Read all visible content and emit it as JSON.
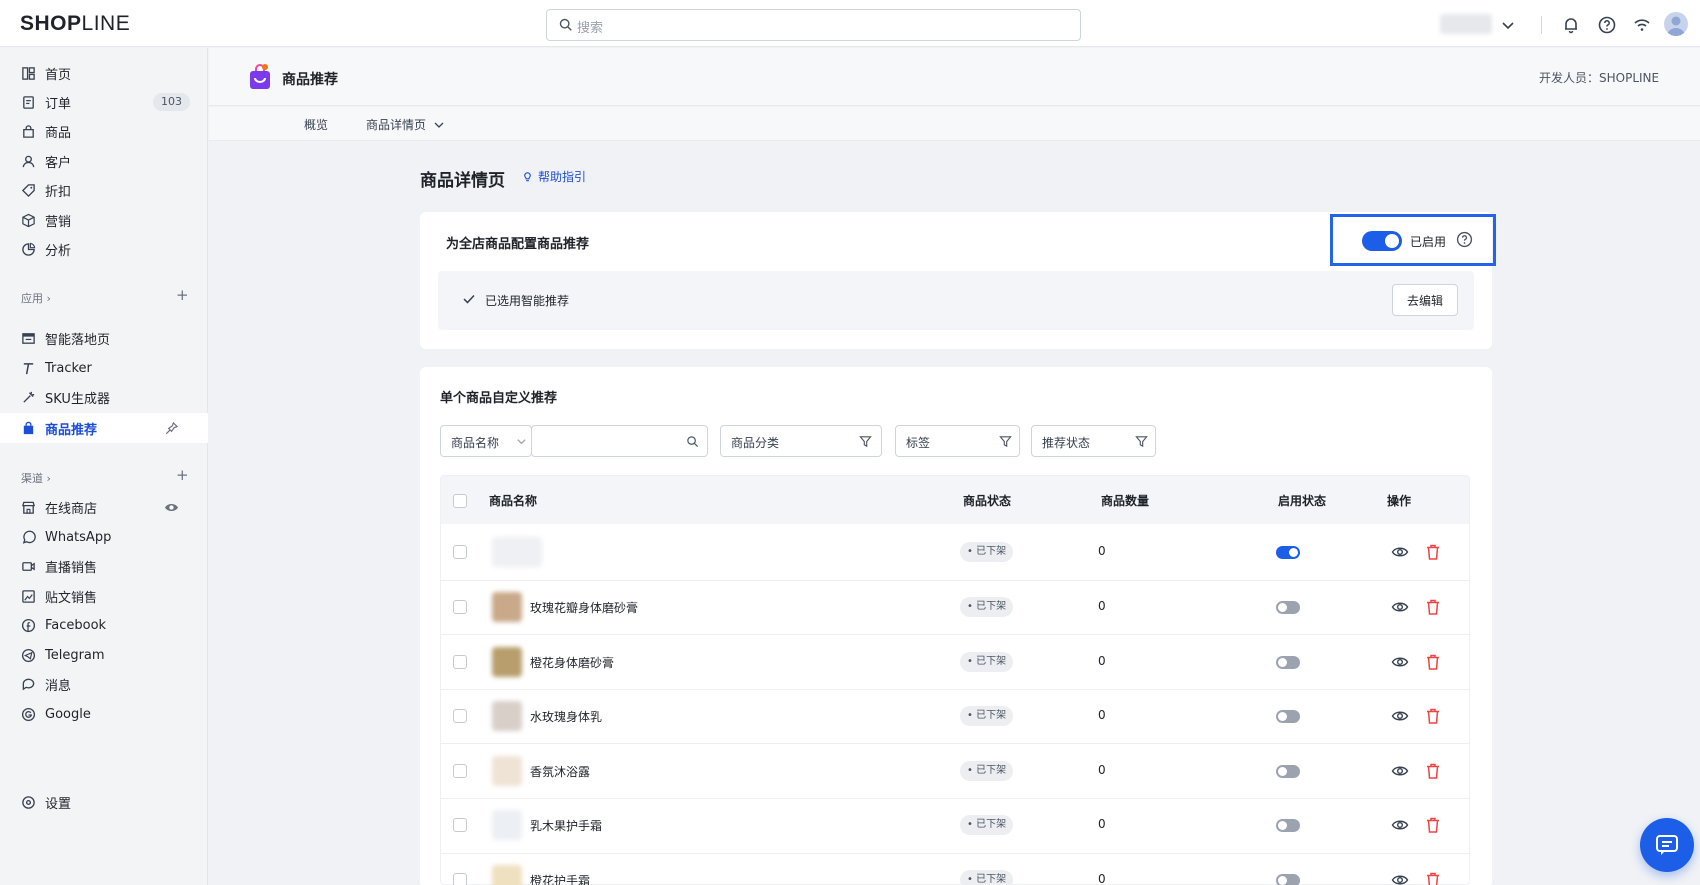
{
  "brand": {
    "logo_bold": "SHOP",
    "logo_mid": "LINE"
  },
  "topbar": {
    "search_placeholder": "搜索"
  },
  "sidebar": {
    "items": [
      {
        "label": "首页",
        "icon": "home-grid-icon"
      },
      {
        "label": "订单",
        "icon": "order-icon",
        "badge": "103"
      },
      {
        "label": "商品",
        "icon": "product-bag-icon"
      },
      {
        "label": "客户",
        "icon": "customer-icon"
      },
      {
        "label": "折扣",
        "icon": "discount-tag-icon"
      },
      {
        "label": "营销",
        "icon": "marketing-box-icon"
      },
      {
        "label": "分析",
        "icon": "analytics-icon"
      }
    ],
    "apps_title": "应用",
    "apps": [
      {
        "label": "智能落地页",
        "icon": "landing-page-icon"
      },
      {
        "label": "Tracker",
        "icon": "tracker-icon"
      },
      {
        "label": "SKU生成器",
        "icon": "sku-generator-icon"
      }
    ],
    "active_app": {
      "label": "商品推荐",
      "icon": "product-recommend-icon"
    },
    "channels_title": "渠道",
    "channels": [
      {
        "label": "在线商店",
        "icon": "online-store-icon"
      },
      {
        "label": "WhatsApp",
        "icon": "whatsapp-icon"
      },
      {
        "label": "直播销售",
        "icon": "live-sales-icon"
      },
      {
        "label": "贴文销售",
        "icon": "post-sales-icon"
      },
      {
        "label": "Facebook",
        "icon": "facebook-icon"
      },
      {
        "label": "Telegram",
        "icon": "telegram-icon"
      },
      {
        "label": "消息",
        "icon": "message-icon"
      },
      {
        "label": "Google",
        "icon": "google-icon"
      }
    ],
    "settings": {
      "label": "设置",
      "icon": "settings-icon"
    }
  },
  "header": {
    "app_name": "商品推荐",
    "developer": "开发人员：SHOPLINE",
    "tabs": [
      "概览",
      "商品详情页"
    ]
  },
  "main": {
    "title": "商品详情页",
    "help": "帮助指引",
    "global_card": {
      "title": "为全店商品配置商品推荐",
      "toggle_label": "已启用",
      "selected_text": "已选用智能推荐",
      "edit_button": "去编辑"
    },
    "custom_card": {
      "title": "单个商品自定义推荐",
      "filters": {
        "name_select": "商品名称",
        "category": "商品分类",
        "tag": "标签",
        "status": "推荐状态"
      },
      "columns": [
        "商品名称",
        "商品状态",
        "商品数量",
        "启用状态",
        "操作"
      ],
      "rows": [
        {
          "name": "",
          "status": "已下架",
          "qty": "0",
          "enabled": true
        },
        {
          "name": "玫瑰花瓣身体磨砂膏",
          "status": "已下架",
          "qty": "0",
          "enabled": false
        },
        {
          "name": "橙花身体磨砂膏",
          "status": "已下架",
          "qty": "0",
          "enabled": false
        },
        {
          "name": "水玫瑰身体乳",
          "status": "已下架",
          "qty": "0",
          "enabled": false
        },
        {
          "name": "香氛沐浴露",
          "status": "已下架",
          "qty": "0",
          "enabled": false
        },
        {
          "name": "乳木果护手霜",
          "status": "已下架",
          "qty": "0",
          "enabled": false
        },
        {
          "name": "橙花护手霜",
          "status": "已下架",
          "qty": "0",
          "enabled": false
        }
      ]
    }
  },
  "colors": {
    "accent": "#1d5ee8",
    "danger": "#ef4444",
    "highlight": "#2563eb"
  }
}
